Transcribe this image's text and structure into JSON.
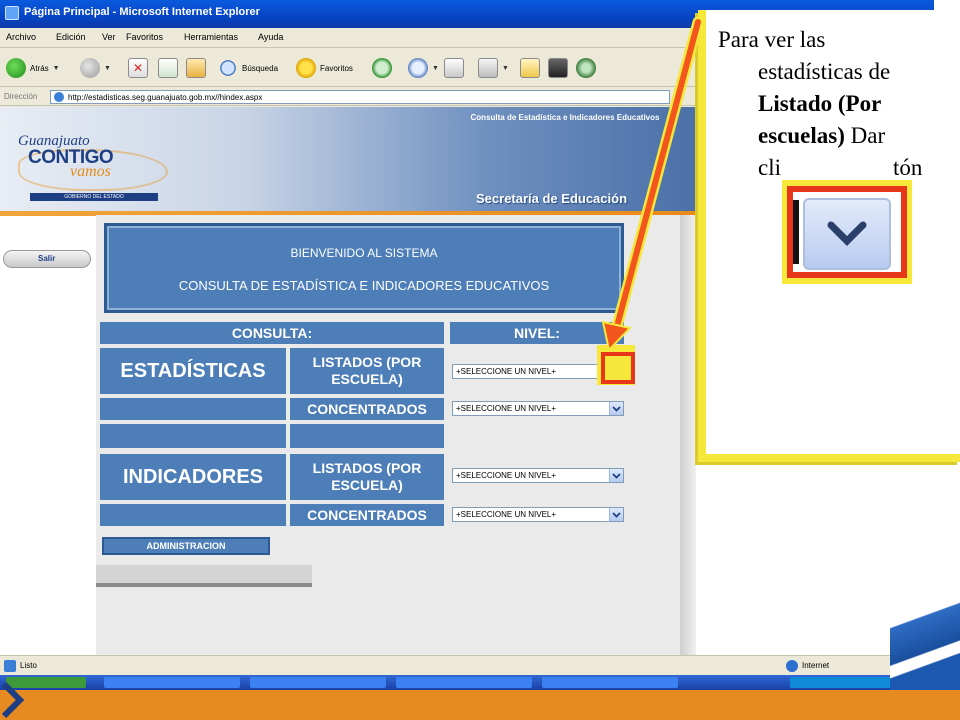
{
  "window": {
    "title": "Página Principal - Microsoft Internet Explorer"
  },
  "menu": [
    "Archivo",
    "Edición",
    "Ver",
    "Favoritos",
    "Herramientas",
    "Ayuda"
  ],
  "toolbar": {
    "back_label": "Atrás",
    "search_label": "Búsqueda",
    "favorites_label": "Favoritos"
  },
  "address": {
    "label": "Dirección",
    "url": "http://estadisticas.seg.guanajuato.gob.mx//hindex.aspx"
  },
  "banner": {
    "logo_top": "Guanajuato",
    "logo_main": "CONTIGO",
    "logo_vamos": "vamos",
    "logo_strip": "GOBIERNO DEL ESTADO",
    "consulta": "Consulta de Estadística e Indicadores Educativos",
    "secretaria": "Secretaría de Educación"
  },
  "salir_label": "Salir",
  "welcome": {
    "line1": "BIENVENIDO AL SISTEMA",
    "line2": "CONSULTA DE ESTADÍSTICA E INDICADORES EDUCATIVOS"
  },
  "table": {
    "header_consulta": "CONSULTA:",
    "header_nivel": "NIVEL:",
    "estadisticas": "ESTADÍSTICAS",
    "indicadores": "INDICADORES",
    "listados_line1": "LISTADOS (POR",
    "listados_line2": "ESCUELA)",
    "concentrados": "CONCENTRADOS",
    "select_placeholder": "+SELECCIONE UN NIVEL+"
  },
  "admin_label": "ADMINISTRACION",
  "status": {
    "left": "Listo",
    "zone": "Internet"
  },
  "callout": {
    "line1": "Para ver las",
    "line2": "estadísticas de",
    "bold1": "Listado (Por",
    "bold2": "escuelas)",
    "after_bold": " Dar",
    "line5_start": "cli",
    "line5_end": "tón"
  },
  "colors": {
    "panel_blue": "#4d7eb8",
    "highlight_yellow": "#f5e83a",
    "highlight_red": "#e8361a",
    "arrow_orange": "#f2561d",
    "slide_orange": "#e78b21"
  }
}
